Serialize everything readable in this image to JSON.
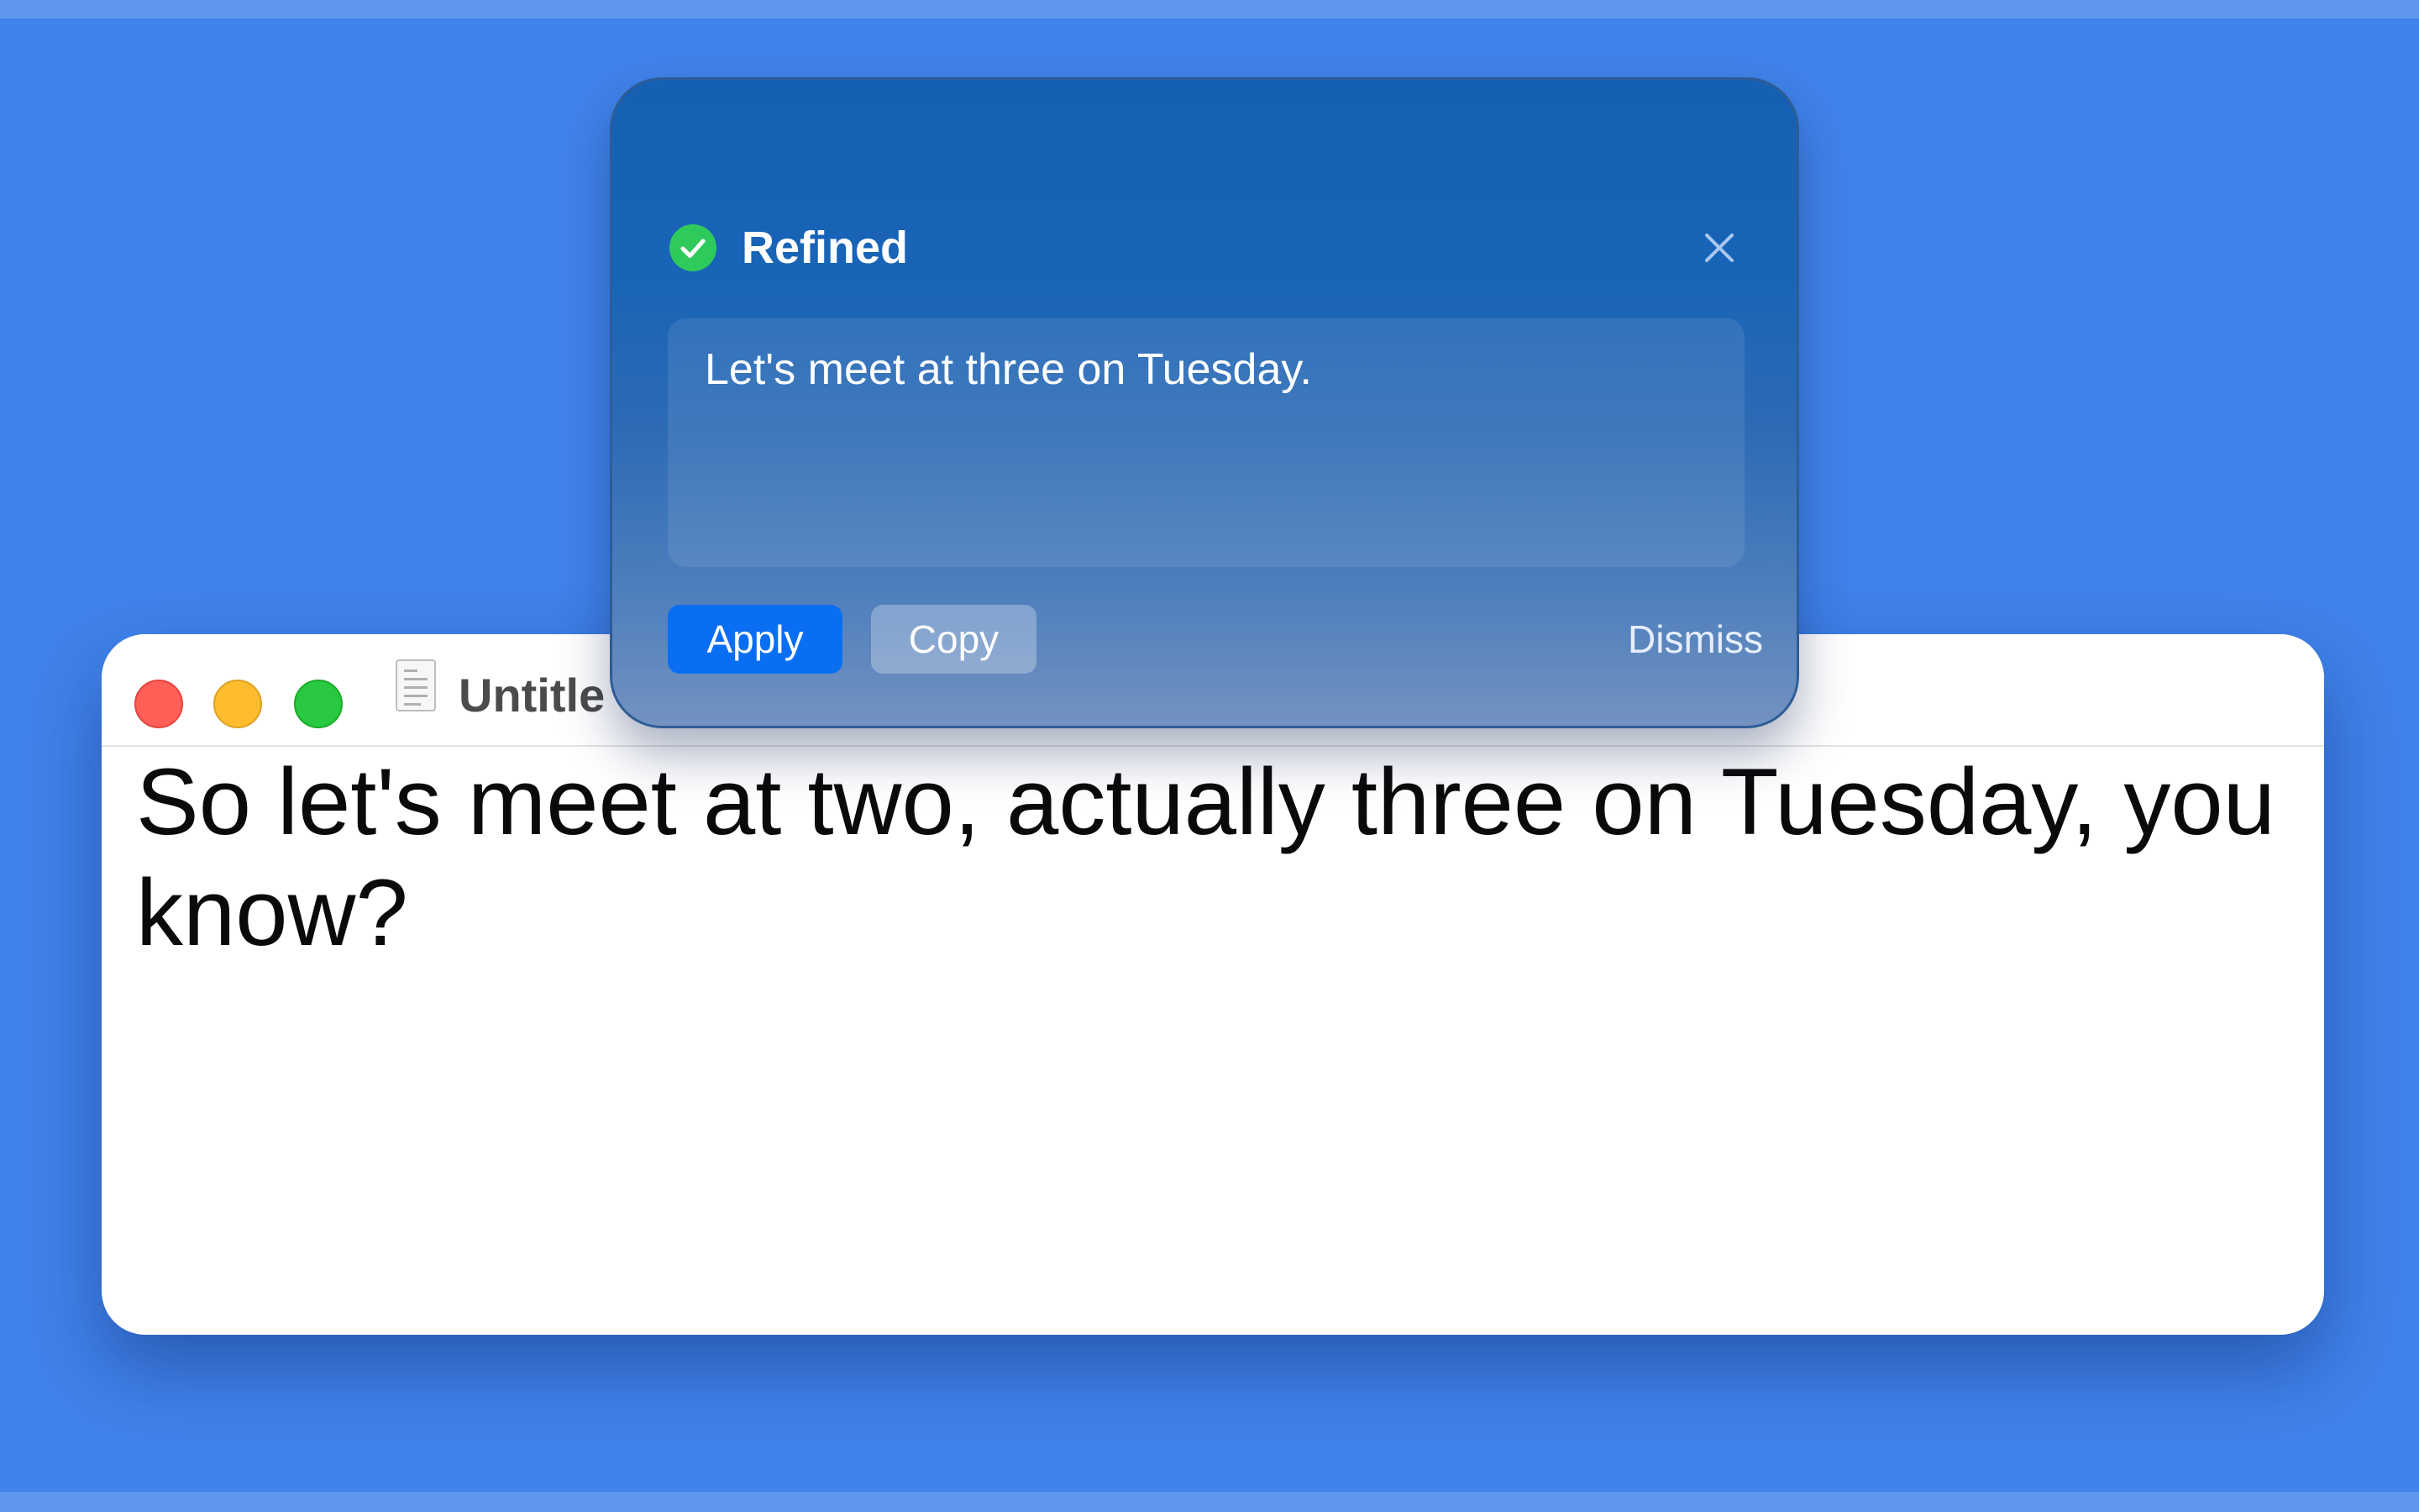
{
  "editor": {
    "window_title": "Untitle",
    "body_text": "So let's meet at two, actually three on Tuesday, you know?"
  },
  "popup": {
    "title": "Refined",
    "status_icon": "checkmark-circle-icon",
    "result_text": "Let's meet at three on Tuesday.",
    "apply_label": "Apply",
    "copy_label": "Copy",
    "dismiss_label": "Dismiss"
  },
  "colors": {
    "desktop": "#4083ea",
    "accent": "#0a6ef2",
    "success": "#2fca5c"
  }
}
